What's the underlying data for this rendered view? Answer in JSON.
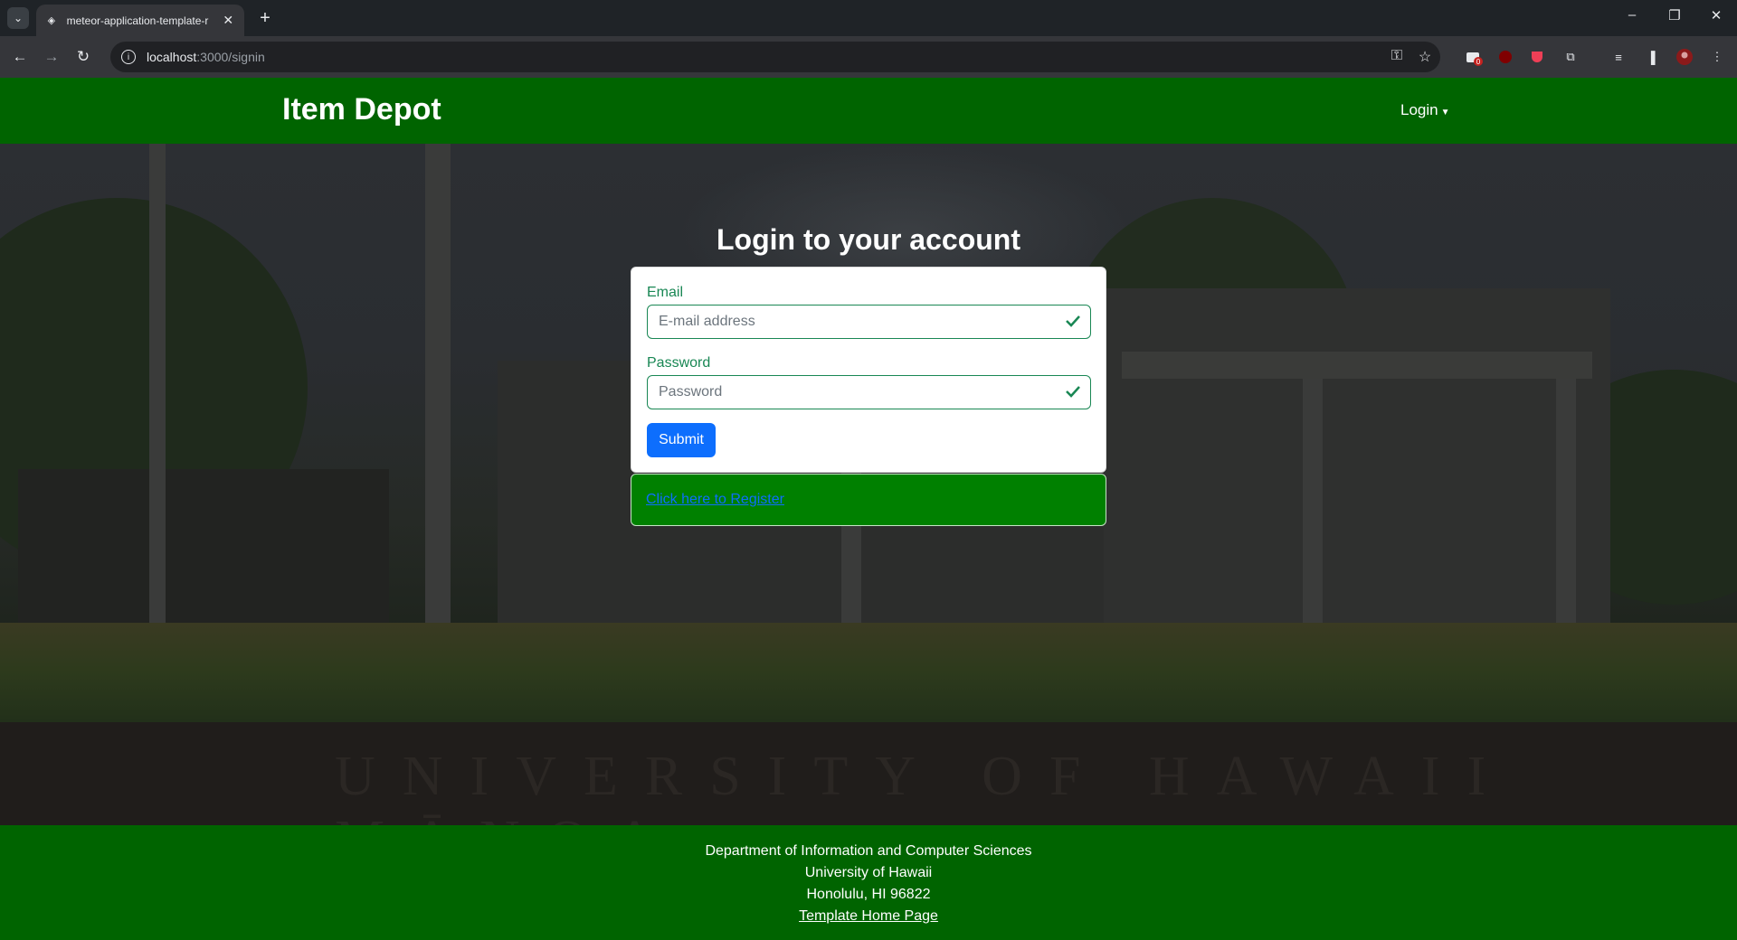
{
  "browser": {
    "tab_title": "meteor-application-template-r",
    "url_host": "localhost",
    "url_path": ":3000/signin",
    "extension_badge": "0"
  },
  "navbar": {
    "brand": "Item Depot",
    "login_label": "Login"
  },
  "hero": {
    "wall_text": "UNIVERSITY OF HAWAII MĀNOA"
  },
  "login": {
    "heading": "Login to your account",
    "email_label": "Email",
    "email_placeholder": "E-mail address",
    "password_label": "Password",
    "password_placeholder": "Password",
    "submit_label": "Submit",
    "register_link": "Click here to Register"
  },
  "footer": {
    "line1": "Department of Information and Computer Sciences",
    "line2": "University of Hawaii",
    "line3": "Honolulu, HI 96822",
    "link": "Template Home Page"
  },
  "colors": {
    "navbar": "#006400",
    "register_bg": "#008000",
    "valid": "#198754",
    "primary": "#0d6efd"
  }
}
